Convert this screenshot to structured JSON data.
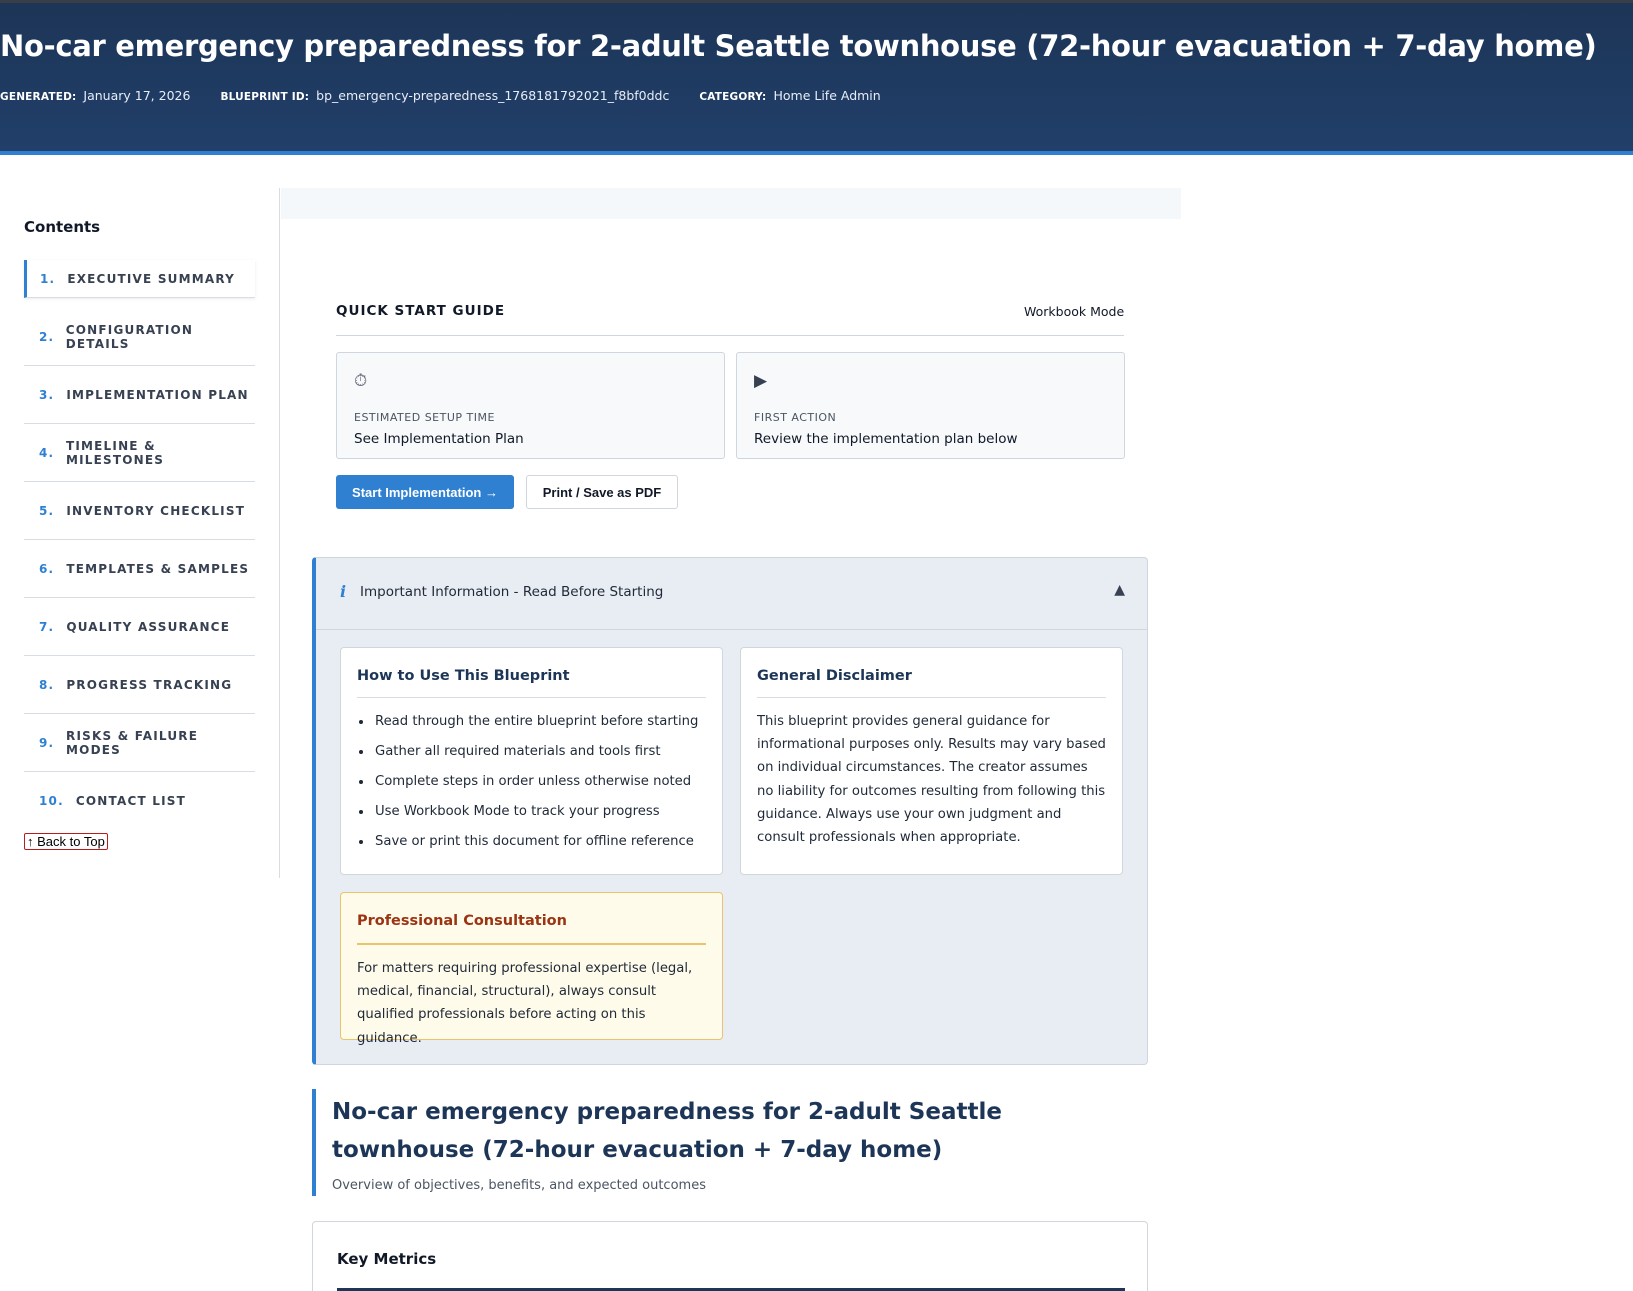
{
  "header": {
    "title": "No-car emergency preparedness for 2-adult Seattle townhouse (72-hour evacuation + 7-day home)",
    "meta": [
      {
        "key": "GENERATED:",
        "value": "January 17, 2026"
      },
      {
        "key": "BLUEPRINT ID:",
        "value": "bp_emergency-preparedness_1768181792021_f8bf0ddc"
      },
      {
        "key": "CATEGORY:",
        "value": "Home Life Admin"
      }
    ]
  },
  "sidebar": {
    "heading": "Contents",
    "items": [
      {
        "num": "1.",
        "label": "EXECUTIVE SUMMARY"
      },
      {
        "num": "2.",
        "label": "CONFIGURATION DETAILS"
      },
      {
        "num": "3.",
        "label": "IMPLEMENTATION PLAN"
      },
      {
        "num": "4.",
        "label": "TIMELINE & MILESTONES"
      },
      {
        "num": "5.",
        "label": "INVENTORY CHECKLIST"
      },
      {
        "num": "6.",
        "label": "TEMPLATES & SAMPLES"
      },
      {
        "num": "7.",
        "label": "QUALITY ASSURANCE"
      },
      {
        "num": "8.",
        "label": "PROGRESS TRACKING"
      },
      {
        "num": "9.",
        "label": "RISKS & FAILURE MODES"
      },
      {
        "num": "10.",
        "label": "CONTACT LIST"
      }
    ],
    "back_to_top": "↑ Back to Top"
  },
  "quick_start": {
    "title": "QUICK START GUIDE",
    "mode": "Workbook Mode",
    "cards": [
      {
        "icon": "stopwatch-icon",
        "glyph": "⏱",
        "label": "ESTIMATED SETUP TIME",
        "value": "See Implementation Plan"
      },
      {
        "icon": "play-icon",
        "glyph": "▶",
        "label": "FIRST ACTION",
        "value": "Review the implementation plan below"
      }
    ],
    "primary_button": "Start Implementation →",
    "secondary_button": "Print / Save as PDF"
  },
  "important": {
    "title": "Important Information - Read Before Starting",
    "how_to": {
      "title": "How to Use This Blueprint",
      "items": [
        "Read through the entire blueprint before starting",
        "Gather all required materials and tools first",
        "Complete steps in order unless otherwise noted",
        "Use Workbook Mode to track your progress",
        "Save or print this document for offline reference"
      ]
    },
    "disclaimer": {
      "title": "General Disclaimer",
      "text": "This blueprint provides general guidance for informational purposes only. Results may vary based on individual circumstances. The creator assumes no liability for outcomes resulting from following this guidance. Always use your own judgment and consult professionals when appropriate."
    },
    "professional": {
      "title": "Professional Consultation",
      "text": "For matters requiring professional expertise (legal, medical, financial, structural), always consult qualified professionals before acting on this guidance."
    }
  },
  "section": {
    "title": "No-car emergency preparedness for 2-adult Seattle townhouse (72-hour evacuation + 7-day home)",
    "subtitle": "Overview of objectives, benefits, and expected outcomes"
  },
  "metrics": {
    "title": "Key Metrics"
  },
  "colors": {
    "header_bg": "#1d3557",
    "accent": "#2f80d1",
    "warning_border": "#e9c46a"
  }
}
